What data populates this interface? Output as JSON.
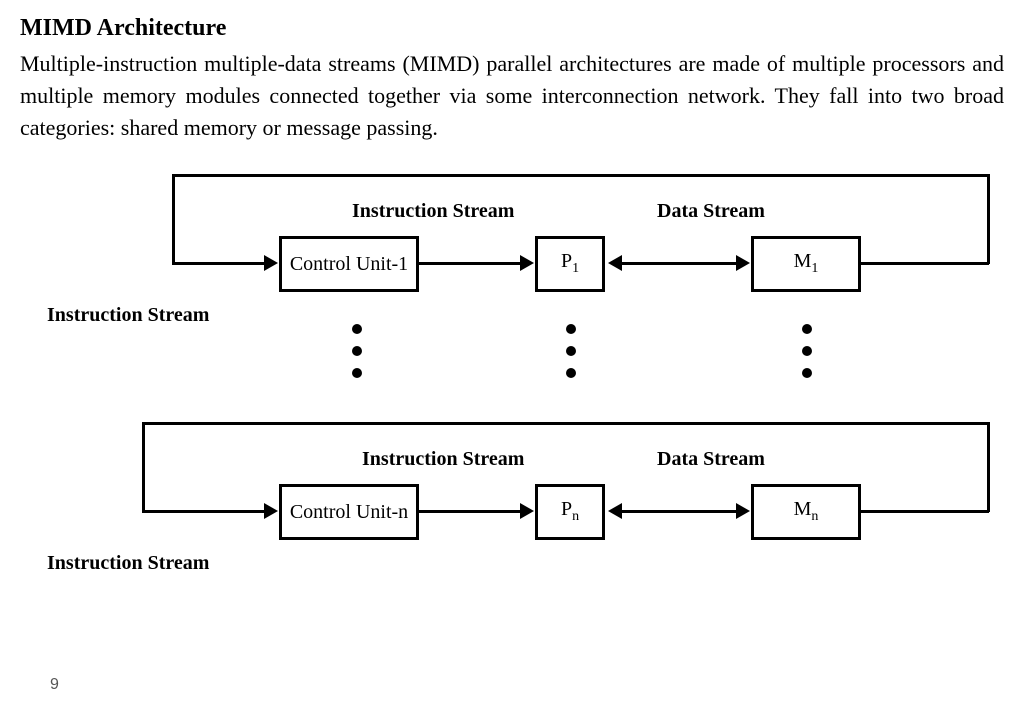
{
  "heading": "MIMD Architecture",
  "body": "Multiple-instruction multiple-data streams (MIMD) parallel architectures are made of multiple processors and multiple memory modules connected together via some interconnection network. They fall into two broad categories: shared memory or message passing.",
  "diagram": {
    "top_labels": {
      "instruction_stream": "Instruction Stream",
      "data_stream": "Data Stream"
    },
    "row1": {
      "control": "Control Unit-1",
      "p": "P",
      "p_sub": "1",
      "m": "M",
      "m_sub": "1"
    },
    "rown": {
      "control": "Control Unit-n",
      "p": "P",
      "p_sub": "n",
      "m": "M",
      "m_sub": "n"
    },
    "left_label": "Instruction Stream",
    "mid_labels": {
      "instruction_stream": "Instruction Stream",
      "data_stream": "Data Stream"
    }
  },
  "page_number": "9"
}
